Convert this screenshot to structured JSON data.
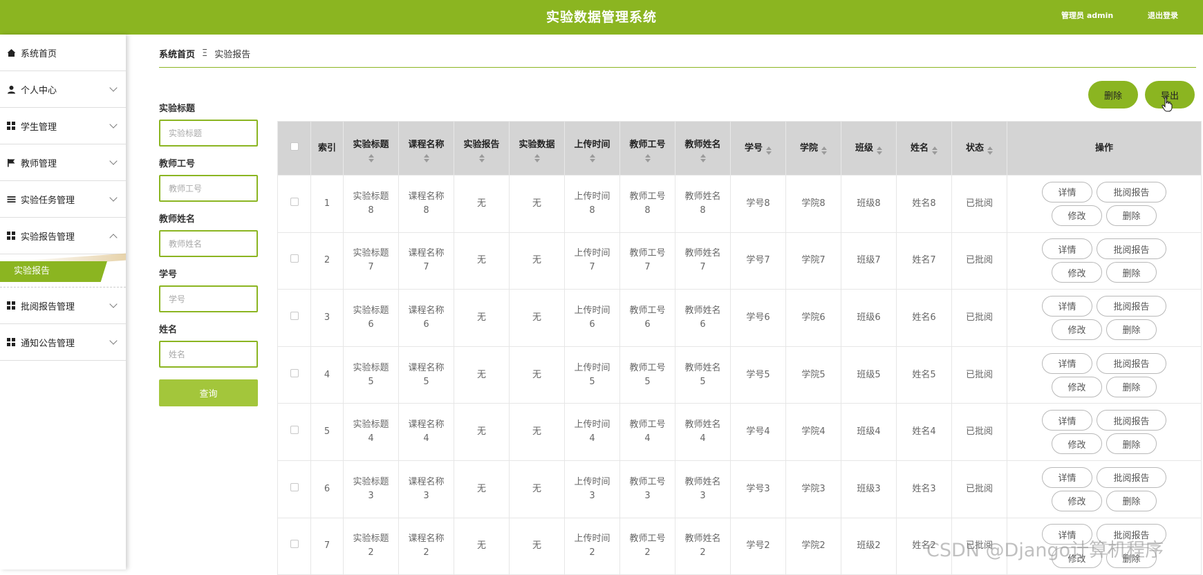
{
  "header": {
    "title": "实验数据管理系统",
    "user": "管理员 admin",
    "logout": "退出登录"
  },
  "sidebar": {
    "items": [
      {
        "label": "系统首页",
        "icon": "home-icon"
      },
      {
        "label": "个人中心",
        "icon": "user-icon"
      },
      {
        "label": "学生管理",
        "icon": "grid-icon"
      },
      {
        "label": "教师管理",
        "icon": "flag-icon"
      },
      {
        "label": "实验任务管理",
        "icon": "list-icon"
      },
      {
        "label": "实验报告管理",
        "icon": "grid-icon"
      },
      {
        "label": "批阅报告管理",
        "icon": "grid-icon"
      },
      {
        "label": "通知公告管理",
        "icon": "grid-icon"
      }
    ],
    "active_sub": "实验报告"
  },
  "breadcrumb": {
    "home": "系统首页",
    "separator": "Ξ",
    "current": "实验报告"
  },
  "filters": {
    "title_label": "实验标题",
    "title_placeholder": "实验标题",
    "teacher_no_label": "教师工号",
    "teacher_no_placeholder": "教师工号",
    "teacher_name_label": "教师姓名",
    "teacher_name_placeholder": "教师姓名",
    "student_no_label": "学号",
    "student_no_placeholder": "学号",
    "name_label": "姓名",
    "name_placeholder": "姓名",
    "query_button": "查询"
  },
  "toolbar": {
    "delete": "删除",
    "export": "导出"
  },
  "table": {
    "headers": [
      "索引",
      "实验标题",
      "课程名称",
      "实验报告",
      "实验数据",
      "上传时间",
      "教师工号",
      "教师姓名",
      "学号",
      "学院",
      "班级",
      "姓名",
      "状态",
      "操作"
    ],
    "rows": [
      {
        "index": "1",
        "title": [
          "实验标题",
          "8"
        ],
        "course": [
          "课程名称",
          "8"
        ],
        "report": "无",
        "data": "无",
        "upload": [
          "上传时间",
          "8"
        ],
        "tno": [
          "教师工号",
          "8"
        ],
        "tname": [
          "教师姓名",
          "8"
        ],
        "sno": "学号8",
        "college": "学院8",
        "class": "班级8",
        "name": "姓名8",
        "status": "已批阅"
      },
      {
        "index": "2",
        "title": [
          "实验标题",
          "7"
        ],
        "course": [
          "课程名称",
          "7"
        ],
        "report": "无",
        "data": "无",
        "upload": [
          "上传时间",
          "7"
        ],
        "tno": [
          "教师工号",
          "7"
        ],
        "tname": [
          "教师姓名",
          "7"
        ],
        "sno": "学号7",
        "college": "学院7",
        "class": "班级7",
        "name": "姓名7",
        "status": "已批阅"
      },
      {
        "index": "3",
        "title": [
          "实验标题",
          "6"
        ],
        "course": [
          "课程名称",
          "6"
        ],
        "report": "无",
        "data": "无",
        "upload": [
          "上传时间",
          "6"
        ],
        "tno": [
          "教师工号",
          "6"
        ],
        "tname": [
          "教师姓名",
          "6"
        ],
        "sno": "学号6",
        "college": "学院6",
        "class": "班级6",
        "name": "姓名6",
        "status": "已批阅"
      },
      {
        "index": "4",
        "title": [
          "实验标题",
          "5"
        ],
        "course": [
          "课程名称",
          "5"
        ],
        "report": "无",
        "data": "无",
        "upload": [
          "上传时间",
          "5"
        ],
        "tno": [
          "教师工号",
          "5"
        ],
        "tname": [
          "教师姓名",
          "5"
        ],
        "sno": "学号5",
        "college": "学院5",
        "class": "班级5",
        "name": "姓名5",
        "status": "已批阅"
      },
      {
        "index": "5",
        "title": [
          "实验标题",
          "4"
        ],
        "course": [
          "课程名称",
          "4"
        ],
        "report": "无",
        "data": "无",
        "upload": [
          "上传时间",
          "4"
        ],
        "tno": [
          "教师工号",
          "4"
        ],
        "tname": [
          "教师姓名",
          "4"
        ],
        "sno": "学号4",
        "college": "学院4",
        "class": "班级4",
        "name": "姓名4",
        "status": "已批阅"
      },
      {
        "index": "6",
        "title": [
          "实验标题",
          "3"
        ],
        "course": [
          "课程名称",
          "3"
        ],
        "report": "无",
        "data": "无",
        "upload": [
          "上传时间",
          "3"
        ],
        "tno": [
          "教师工号",
          "3"
        ],
        "tname": [
          "教师姓名",
          "3"
        ],
        "sno": "学号3",
        "college": "学院3",
        "class": "班级3",
        "name": "姓名3",
        "status": "已批阅"
      },
      {
        "index": "7",
        "title": [
          "实验标题",
          "2"
        ],
        "course": [
          "课程名称",
          "2"
        ],
        "report": "无",
        "data": "无",
        "upload": [
          "上传时间",
          "2"
        ],
        "tno": [
          "教师工号",
          "2"
        ],
        "tname": [
          "教师姓名",
          "2"
        ],
        "sno": "学号2",
        "college": "学院2",
        "class": "班级2",
        "name": "姓名2",
        "status": "已批阅"
      }
    ],
    "actions": {
      "detail": "详情",
      "review": "批阅报告",
      "edit": "修改",
      "delete": "删除"
    }
  },
  "watermark": "CSDN @Django计算机程序",
  "colors": {
    "primary": "#8bb521",
    "header_bg": "#d4d4d4",
    "query": "#a3c63b"
  }
}
